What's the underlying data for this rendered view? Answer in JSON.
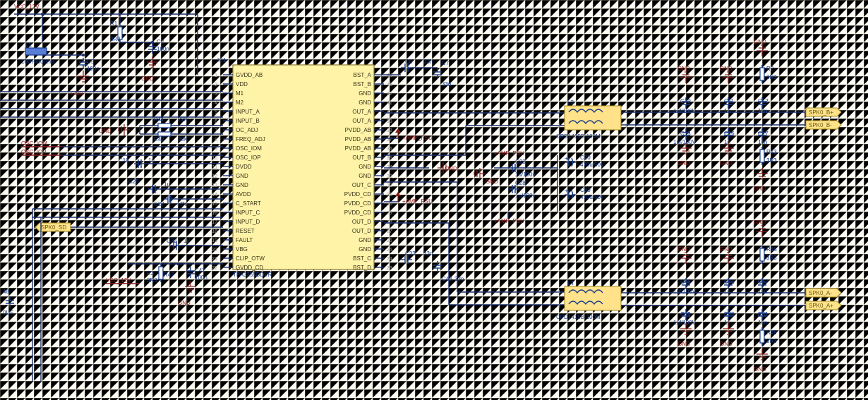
{
  "chart_data": null,
  "power": {
    "vcc": "VCC_12V",
    "amp_psu": "+AMP_PSU",
    "gnd": "GND"
  },
  "inductor_supply": {
    "ref": "L1",
    "value": "10UH/300ma"
  },
  "r1": {
    "ref": "R1",
    "value": "3R3"
  },
  "c2": {
    "ref": "C2",
    "value": "100n"
  },
  "c5": {
    "ref": "C5",
    "value": "100n"
  },
  "ic": {
    "ref": "IC1",
    "name": "TPA3255DDVR",
    "pins_left": [
      {
        "n": "1",
        "f": "GVDD_AB"
      },
      {
        "n": "2",
        "f": "VDD"
      },
      {
        "n": "3",
        "f": "M1"
      },
      {
        "n": "4",
        "f": "M2"
      },
      {
        "n": "5",
        "f": "INPUT_A"
      },
      {
        "n": "6",
        "f": "INPUT_B"
      },
      {
        "n": "7",
        "f": "OC_ADJ"
      },
      {
        "n": "8",
        "f": "FREQ_ADJ"
      },
      {
        "n": "9",
        "f": "OSC_IOM"
      },
      {
        "n": "10",
        "f": "OSC_IOP"
      },
      {
        "n": "11",
        "f": "DVDD"
      },
      {
        "n": "12",
        "f": "GND"
      },
      {
        "n": "13",
        "f": "GND"
      },
      {
        "n": "14",
        "f": "AVDD"
      },
      {
        "n": "15",
        "f": "C_START"
      },
      {
        "n": "16",
        "f": "INPUT_C"
      },
      {
        "n": "17",
        "f": "INPUT_D"
      },
      {
        "n": "18",
        "f": "RESET"
      },
      {
        "n": "19",
        "f": "FAULT"
      },
      {
        "n": "20",
        "f": "VBG"
      },
      {
        "n": "21",
        "f": "CLIP_OTW"
      },
      {
        "n": "22",
        "f": "GVDD_CD"
      }
    ],
    "pins_right": [
      {
        "n": "44",
        "f": "BST_A"
      },
      {
        "n": "43",
        "f": "BST_B"
      },
      {
        "n": "42",
        "f": "GND"
      },
      {
        "n": "41",
        "f": "GND"
      },
      {
        "n": "40",
        "f": "OUT_A"
      },
      {
        "n": "39",
        "f": "OUT_A"
      },
      {
        "n": "38",
        "f": "PVDD_AB"
      },
      {
        "n": "37",
        "f": "PVDD_AB"
      },
      {
        "n": "36",
        "f": "PVDD_AB"
      },
      {
        "n": "35",
        "f": "OUT_B"
      },
      {
        "n": "34",
        "f": "GND"
      },
      {
        "n": "33",
        "f": "GND"
      },
      {
        "n": "32",
        "f": "OUT_C"
      },
      {
        "n": "31",
        "f": "PVDD_CD"
      },
      {
        "n": "30",
        "f": "PVDD_CD"
      },
      {
        "n": "29",
        "f": "PVDD_CD"
      },
      {
        "n": "28",
        "f": "OUT_D"
      },
      {
        "n": "27",
        "f": "OUT_D"
      },
      {
        "n": "26",
        "f": "GND"
      },
      {
        "n": "25",
        "f": "GND"
      },
      {
        "n": "24",
        "f": "BST_C"
      },
      {
        "n": "23",
        "f": "BST_D"
      }
    ]
  },
  "r41": {
    "ref": "R41",
    "value": "22K"
  },
  "r42": {
    "ref": "R42",
    "value": "30K"
  },
  "osc_iom": "OSC_IOM",
  "osc_iop": "OSC_IOP",
  "c19": {
    "ref": "C19",
    "value": "1u"
  },
  "c25": {
    "ref": "C25",
    "value": "1u"
  },
  "c27": {
    "ref": "C27",
    "value": "47N"
  },
  "c32": {
    "ref": "C32",
    "value": "1u"
  },
  "spk0_sd": "SPK0_SD",
  "r3": {
    "ref": "R3",
    "value": "3R3"
  },
  "r47": {
    "ref": "R47",
    "value": ""
  },
  "c42": {
    "ref": "C42",
    "value": "100n"
  },
  "leftstub": {
    "ref": "48",
    "value": "0UF"
  },
  "bst": {
    "c6": {
      "ref": "C6",
      "value": "33n"
    },
    "c7": {
      "ref": "C7",
      "value": "33n"
    },
    "c33": {
      "ref": "C33",
      "value": "33n"
    },
    "c43": {
      "ref": "C43",
      "value": "33n"
    }
  },
  "bulk": {
    "c23": {
      "ref": "C23",
      "value": "1u/100v"
    },
    "c28": {
      "ref": "C28",
      "value": "1u/100v"
    },
    "c20": {
      "ref": "C20",
      "value": "470u/50v"
    },
    "c30": {
      "ref": "C30",
      "value": "470u/50v"
    }
  },
  "filters": {
    "l3": {
      "ref": "L3",
      "value": "CPD1415B-100M"
    },
    "l4": {
      "ref": "L4",
      "value": "CPD1415B-100M"
    }
  },
  "out_top": {
    "c10": {
      "ref": "C10",
      "value": "1uf/100V"
    },
    "c11": {
      "ref": "C11",
      "value": "1n"
    },
    "c12": {
      "ref": "C12",
      "value": "10n"
    },
    "c15": {
      "ref": "C15",
      "value": "1uf/100V"
    },
    "c16": {
      "ref": "C16",
      "value": "1n"
    },
    "c17": {
      "ref": "C17",
      "value": "10n"
    },
    "r2": {
      "ref": "R2",
      "value": "3R3"
    },
    "r43": {
      "ref": "R43",
      "value": "3R3"
    }
  },
  "out_bot": {
    "c45": {
      "ref": "C45",
      "value": "1uf/100V"
    },
    "c46": {
      "ref": "C46",
      "value": "1n"
    },
    "c47": {
      "ref": "C47",
      "value": "10n"
    },
    "c49": {
      "ref": "C49",
      "value": "1uf/100V"
    },
    "c50": {
      "ref": "C50",
      "value": "1n"
    },
    "c51": {
      "ref": "C51",
      "value": "10n"
    },
    "r46": {
      "ref": "R46",
      "value": "3R3"
    },
    "r49": {
      "ref": "R49",
      "value": "3R3"
    }
  },
  "ports": {
    "b_plus": "SPK0_B+",
    "b_minus": "SPK0_B-",
    "a_minus": "SPK0_A-",
    "a_plus": "SPK0_A+"
  },
  "misc_gnd_labels": [
    "GND",
    "GND",
    "GND",
    "GND",
    "GND",
    "GND",
    "GND",
    "GND",
    "GND",
    "GND",
    "GND",
    "GND"
  ]
}
